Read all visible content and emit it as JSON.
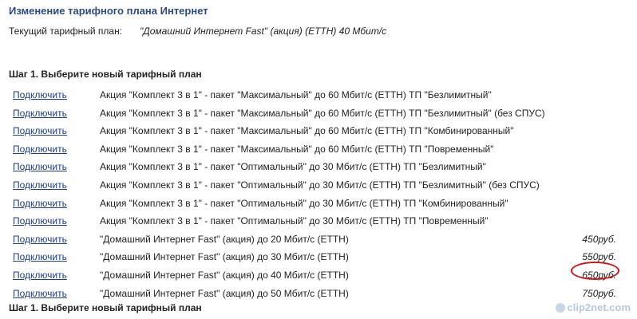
{
  "header": {
    "title": "Изменение тарифного плана Интернет",
    "current_plan_label": "Текущий тарифный план:",
    "current_plan_value": "\"Домашний Интернет Fast\" (акция) (ЕТТН) 40 Мбит/с"
  },
  "step1": {
    "title": "Шаг 1. Выберите новый тарифный план"
  },
  "step2": {
    "title": "Шаг 1. Выберите новый тарифный план"
  },
  "tariffs": [
    {
      "action": "Подключить",
      "name": "Акция \"Комплект 3 в 1\" - пакет \"Максимальный\" до 60 Мбит/с (ЕТТН) ТП \"Безлимитный\"",
      "price": ""
    },
    {
      "action": "Подключить",
      "name": "Акция \"Комплект 3 в 1\" - пакет \"Максимальный\" до 60 Мбит/с (ЕТТН) ТП \"Безлимитный\" (без СПУС)",
      "price": ""
    },
    {
      "action": "Подключить",
      "name": "Акция \"Комплект 3 в 1\" - пакет \"Максимальный\" до 60 Мбит/с (ЕТТН) ТП \"Комбинированный\"",
      "price": ""
    },
    {
      "action": "Подключить",
      "name": "Акция \"Комплект 3 в 1\" - пакет \"Максимальный\" до 60 Мбит/с (ЕТТН) ТП \"Повременный\"",
      "price": ""
    },
    {
      "action": "Подключить",
      "name": "Акция \"Комплект 3 в 1\" - пакет \"Оптимальный\" до 30 Мбит/с (ЕТТН) ТП \"Безлимитный\"",
      "price": ""
    },
    {
      "action": "Подключить",
      "name": "Акция \"Комплект 3 в 1\" - пакет \"Оптимальный\" до 30 Мбит/с (ЕТТН) ТП \"Безлимитный\" (без СПУС)",
      "price": ""
    },
    {
      "action": "Подключить",
      "name": "Акция \"Комплект 3 в 1\" - пакет \"Оптимальный\" до 30 Мбит/с (ЕТТН) ТП \"Комбинированный\"",
      "price": ""
    },
    {
      "action": "Подключить",
      "name": "Акция \"Комплект 3 в 1\" - пакет \"Оптимальный\" до 30 Мбит/с (ЕТТН) ТП \"Повременный\"",
      "price": ""
    },
    {
      "action": "Подключить",
      "name": "\"Домашний Интернет Fast\" (акция) до 20 Мбит/с (ЕТТН)",
      "price": "450руб."
    },
    {
      "action": "Подключить",
      "name": "\"Домашний Интернет Fast\" (акция) до 30 Мбит/с (ЕТТН)",
      "price": "550руб."
    },
    {
      "action": "Подключить",
      "name": "\"Домашний Интернет Fast\" (акция) до 40 Мбит/с (ЕТТН)",
      "price": "650руб."
    },
    {
      "action": "Подключить",
      "name": "\"Домашний Интернет Fast\" (акция) до 50 Мбит/с (ЕТТН)",
      "price": "750руб."
    }
  ],
  "watermark": {
    "text": "clip2net.com"
  },
  "colors": {
    "title": "#2b4a88",
    "link": "#1a3d8f",
    "highlight": "#d11414"
  }
}
